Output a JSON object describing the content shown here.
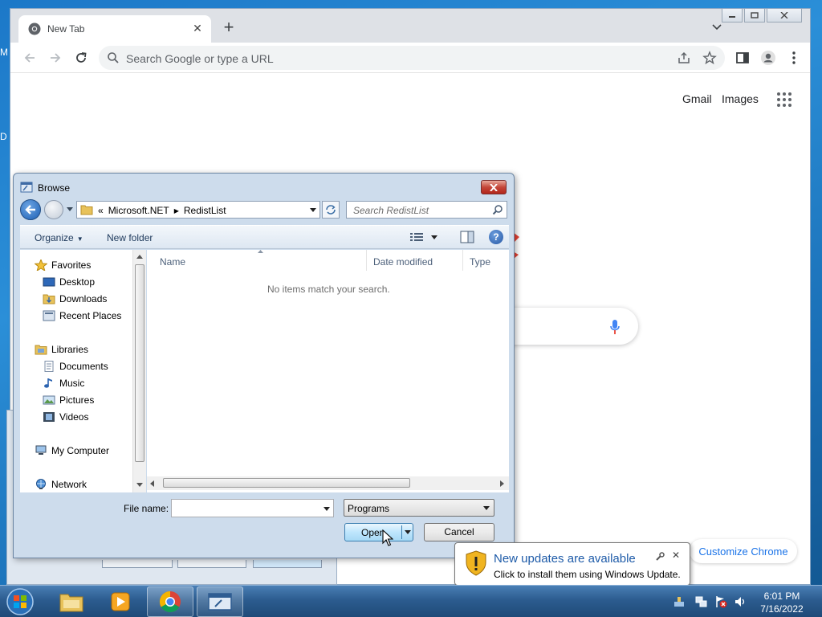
{
  "desktop": {
    "left_letters": [
      "M",
      "D"
    ]
  },
  "chrome": {
    "tab": {
      "title": "New Tab"
    },
    "omnibox": {
      "placeholder": "Search Google or type a URL"
    },
    "ntp": {
      "links": [
        "Gmail",
        "Images"
      ],
      "customize_label": "Customize Chrome"
    }
  },
  "browse": {
    "title": "Browse",
    "path": [
      "Microsoft.NET",
      "RedistList"
    ],
    "path_prefix": "«",
    "search_placeholder": "Search RedistList",
    "toolbar": {
      "organize": "Organize",
      "new_folder": "New folder"
    },
    "nav": {
      "favorites": "Favorites",
      "favorite_items": [
        "Desktop",
        "Downloads",
        "Recent Places"
      ],
      "libraries": "Libraries",
      "library_items": [
        "Documents",
        "Music",
        "Pictures",
        "Videos"
      ],
      "computer": "My Computer",
      "network": "Network"
    },
    "columns": [
      "Name",
      "Date modified",
      "Type"
    ],
    "empty_message": "No items match your search.",
    "file_name_label": "File name:",
    "file_name_value": "",
    "file_type": "Programs",
    "open_label": "Open",
    "cancel_label": "Cancel"
  },
  "notification": {
    "title": "New updates are available",
    "text": "Click to install them using Windows Update."
  },
  "taskbar": {
    "apps": [
      "explorer-icon",
      "media-player-icon",
      "chrome-icon",
      "window-app-icon"
    ],
    "time": "6:01 PM",
    "date": "7/16/2022"
  },
  "colors": {
    "accent": "#1a73e8",
    "dialog_frame": "#cddcec",
    "taskbar": "#2c5c8f"
  }
}
